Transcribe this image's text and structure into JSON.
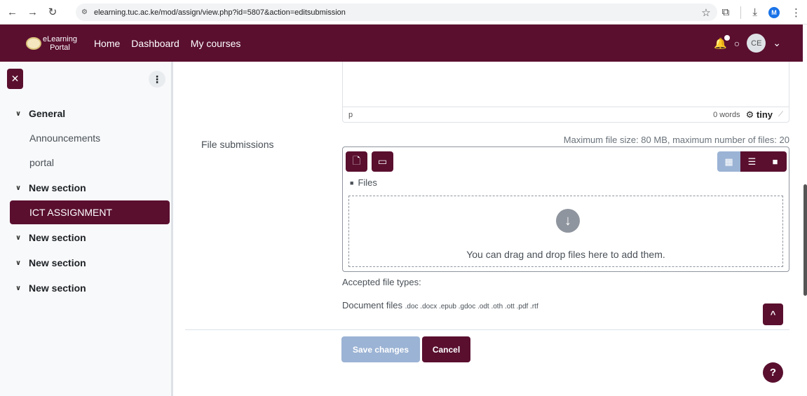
{
  "browser": {
    "url": "elearning.tuc.ac.ke/mod/assign/view.php?id=5807&action=editsubmission",
    "profile_initial": "M"
  },
  "navbar": {
    "logo_line1": "eLearning",
    "logo_line2": "Portal",
    "links": [
      "Home",
      "Dashboard",
      "My courses"
    ],
    "avatar_initials": "CE"
  },
  "drawer": {
    "items": [
      {
        "label": "General"
      },
      {
        "label": "Announcements"
      },
      {
        "label": "portal"
      },
      {
        "label": "New section"
      },
      {
        "label": "ICT ASSIGNMENT"
      },
      {
        "label": "New section"
      },
      {
        "label": "New section"
      },
      {
        "label": "New section"
      }
    ]
  },
  "editor": {
    "path": "p",
    "word_count": "0 words",
    "brand": "tiny"
  },
  "file_submissions": {
    "label": "File submissions",
    "max_info": "Maximum file size: 80 MB, maximum number of files: 20",
    "crumb": "Files",
    "drop_text": "You can drag and drop files here to add them.",
    "accepted_label": "Accepted file types:",
    "types_prefix": "Document files",
    "types_list": ".doc .docx .epub .gdoc .odt .oth .ott .pdf .rtf"
  },
  "actions": {
    "save": "Save changes",
    "cancel": "Cancel"
  }
}
